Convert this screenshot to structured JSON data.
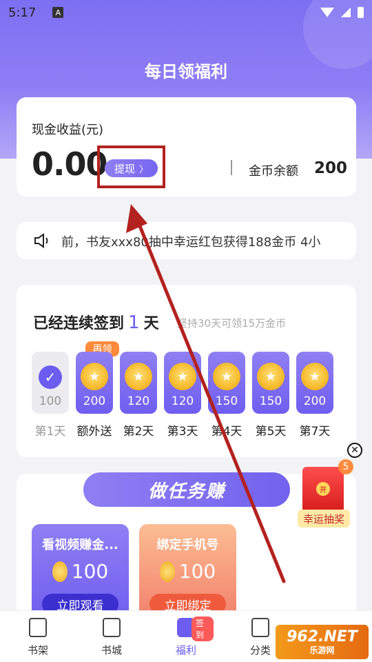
{
  "status_bar": {
    "time": "5:17",
    "notification_glyph": "A"
  },
  "page": {
    "title": "每日领福利"
  },
  "earnings": {
    "label": "现金收益(元)",
    "value": "0.00",
    "withdraw_label": "提现",
    "coin_balance_label": "金币余额",
    "coin_balance_value": "200"
  },
  "notice": {
    "icon": "speaker-icon",
    "text": "前，书友xxx80抽中幸运红包获得188金币  4小"
  },
  "signin": {
    "title_prefix": "已经连续签到",
    "days": "1",
    "title_suffix": "天",
    "hint": "坚持30天可领15万金币",
    "extra_badge": "再领",
    "days_list": [
      {
        "amount": "100",
        "label": "第1天",
        "done": true
      },
      {
        "amount": "200",
        "label": "额外送",
        "done": false
      },
      {
        "amount": "120",
        "label": "第2天",
        "done": false
      },
      {
        "amount": "120",
        "label": "第3天",
        "done": false
      },
      {
        "amount": "150",
        "label": "第4天",
        "done": false
      },
      {
        "amount": "150",
        "label": "第5天",
        "done": false
      },
      {
        "amount": "200",
        "label": "第7天",
        "done": false
      }
    ]
  },
  "tasks": {
    "banner": "做任务赚",
    "items": [
      {
        "title": "看视频赚金...",
        "reward": "100",
        "button": "立即观看"
      },
      {
        "title": "绑定手机号",
        "reward": "100",
        "button": "立即绑定"
      }
    ]
  },
  "lucky": {
    "count": "5",
    "seal": "开",
    "label": "幸运抽奖"
  },
  "tabbar": {
    "items": [
      {
        "label": "书架"
      },
      {
        "label": "书城"
      },
      {
        "label": "福利",
        "badge": "签到"
      },
      {
        "label": "分类"
      }
    ]
  },
  "watermark": {
    "title": "962.NET",
    "subtitle": "乐游网"
  },
  "colors": {
    "accent": "#6c5cf0",
    "highlight": "#b3221f"
  }
}
